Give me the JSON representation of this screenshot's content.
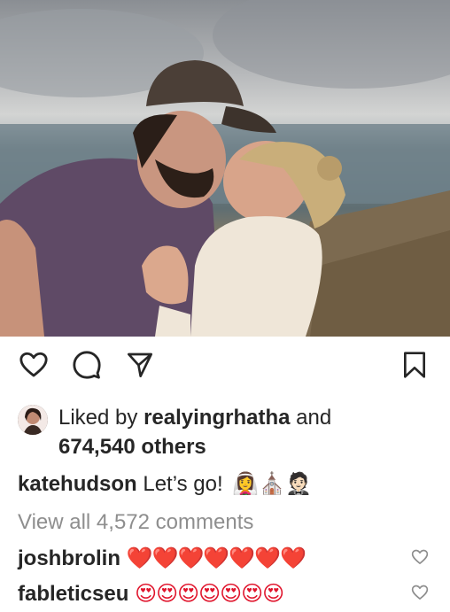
{
  "post": {
    "likes": {
      "prefix": "Liked by",
      "user": "realyingrhatha",
      "conjunction": "and",
      "others": "674,540 others"
    },
    "caption": {
      "author": "katehudson",
      "text": "Let’s go!",
      "emojis": "👰‍♀️⛪🤵🏻"
    },
    "view_all_comments": "View all 4,572 comments",
    "comments": [
      {
        "author": "joshbrolin",
        "text": "❤️❤️❤️❤️❤️❤️❤️"
      },
      {
        "author": "fableticseu",
        "text": "😍😍😍😍😍😍😍"
      }
    ]
  },
  "icons": {
    "like": "heart-outline-icon",
    "comment": "speech-bubble-icon",
    "share": "paper-plane-icon",
    "save": "bookmark-icon",
    "comment_like": "small-heart-icon"
  },
  "colors": {
    "text": "#262626",
    "secondary_text": "#8e8e8e",
    "heart_red": "#e0142c",
    "background": "#ffffff"
  }
}
